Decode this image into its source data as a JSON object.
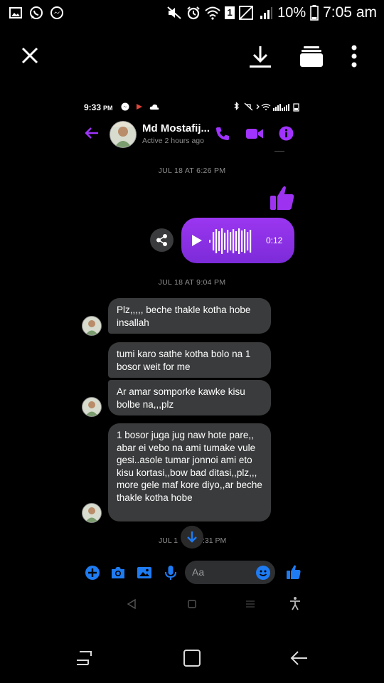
{
  "status_bar": {
    "battery": "10%",
    "time": "7:05 am",
    "notif_count": "1"
  },
  "viewer": {
    "close_icon": "close-icon",
    "download_icon": "download-icon",
    "stack_icon": "stack-icon",
    "more_icon": "more-vertical-icon"
  },
  "inner_status": {
    "time": "9:33",
    "ampm": "PM"
  },
  "chat": {
    "contact_name": "Md Mostafij...",
    "contact_status": "Active 2 hours ago",
    "date1": "JUL 18 AT 6:26 PM",
    "date2": "JUL 18 AT 9:04 PM",
    "date3_left": "JUL 1",
    "date3_right": ":31 PM",
    "voice_duration": "0:12",
    "messages": [
      "Plz,,,,, beche thakle kotha hobe insallah",
      "tumi karo sathe kotha bolo na 1 bosor weit for me",
      "Ar amar somporke kawke kisu bolbe na,,,plz",
      "1 bosor juga jug naw hote pare,, abar ei vebo na ami tumake vule gesi..asole tumar jonnoi ami eto kisu kortasi,,bow bad ditasi,,plz,,, more gele maf kore diyo,,ar beche thakle kotha hobe"
    ]
  },
  "composer": {
    "placeholder": "Aa"
  },
  "colors": {
    "accent": "#8a2be2",
    "messenger_blue": "#1e7bf2",
    "bubble_gray": "#3a3b3c"
  }
}
